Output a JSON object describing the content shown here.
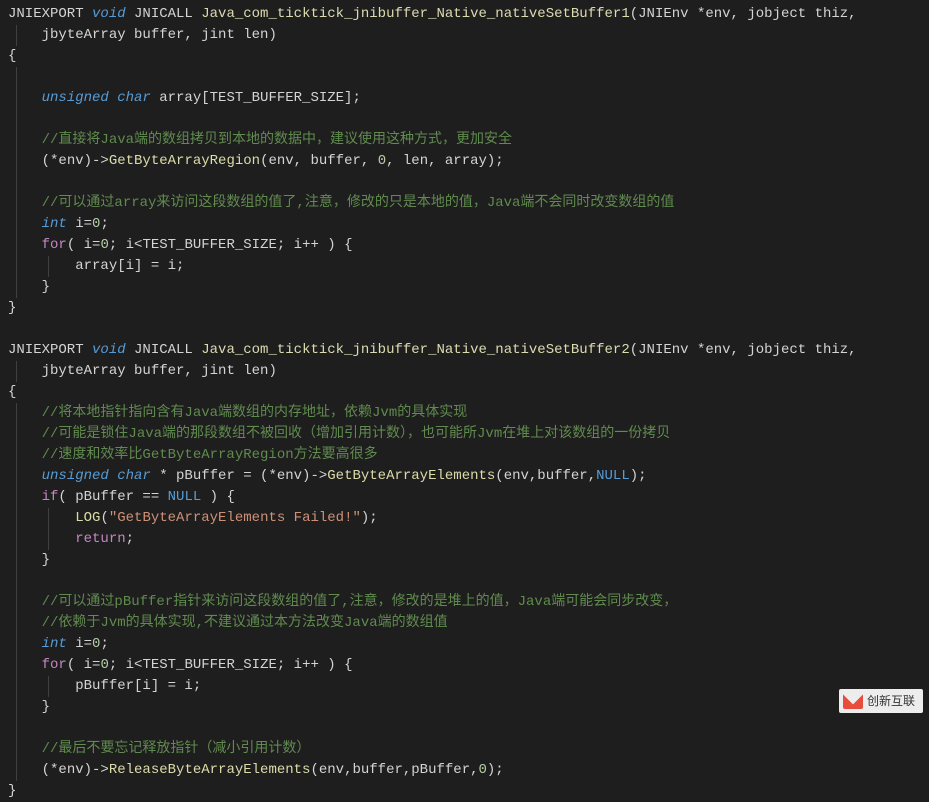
{
  "lines": [
    {
      "i": 0,
      "segs": [
        {
          "c": "macro",
          "t": "JNIEXPORT "
        },
        {
          "c": "kw-type",
          "t": "void"
        },
        {
          "c": "macro",
          "t": " JNICALL "
        },
        {
          "c": "fn-decl",
          "t": "Java_com_ticktick_jnibuffer_Native_nativeSetBuffer1"
        },
        {
          "c": "paren",
          "t": "(JNIEnv *env, jobject thiz, "
        }
      ]
    },
    {
      "i": 1,
      "segs": [
        {
          "c": "paren",
          "t": "jbyteArray buffer, jint len)"
        }
      ]
    },
    {
      "i": 0,
      "segs": [
        {
          "c": "paren",
          "t": "{"
        }
      ]
    },
    {
      "i": 1,
      "blank": true
    },
    {
      "i": 1,
      "segs": [
        {
          "c": "kw-type",
          "t": "unsigned char"
        },
        {
          "c": "op",
          "t": " array[TEST_BUFFER_SIZE];"
        }
      ]
    },
    {
      "i": 1,
      "blank": true
    },
    {
      "i": 1,
      "segs": [
        {
          "c": "comment2",
          "t": "//直接将Java端的数组拷贝到本地的数据中，建议使用这种方式，更加安全"
        }
      ]
    },
    {
      "i": 1,
      "segs": [
        {
          "c": "op",
          "t": "(*env)->"
        },
        {
          "c": "method",
          "t": "GetByteArrayRegion"
        },
        {
          "c": "op",
          "t": "(env, buffer, "
        },
        {
          "c": "num",
          "t": "0"
        },
        {
          "c": "op",
          "t": ", len, array);"
        }
      ]
    },
    {
      "i": 1,
      "blank": true
    },
    {
      "i": 1,
      "segs": [
        {
          "c": "comment2",
          "t": "//可以通过array来访问这段数组的值了,注意，修改的只是本地的值，Java端不会同时改变数组的值"
        }
      ]
    },
    {
      "i": 1,
      "segs": [
        {
          "c": "kw-type",
          "t": "int"
        },
        {
          "c": "op",
          "t": " i="
        },
        {
          "c": "num",
          "t": "0"
        },
        {
          "c": "op",
          "t": ";"
        }
      ]
    },
    {
      "i": 1,
      "segs": [
        {
          "c": "kw-ctrl",
          "t": "for"
        },
        {
          "c": "op",
          "t": "( i="
        },
        {
          "c": "num",
          "t": "0"
        },
        {
          "c": "op",
          "t": "; i<TEST_BUFFER_SIZE; i++ ) {"
        }
      ]
    },
    {
      "i": 2,
      "segs": [
        {
          "c": "op",
          "t": "array[i] = i;"
        }
      ]
    },
    {
      "i": 1,
      "segs": [
        {
          "c": "op",
          "t": "}"
        }
      ]
    },
    {
      "i": 0,
      "segs": [
        {
          "c": "op",
          "t": "}"
        }
      ]
    },
    {
      "i": 0,
      "blank": true
    },
    {
      "i": 0,
      "segs": [
        {
          "c": "macro",
          "t": "JNIEXPORT "
        },
        {
          "c": "kw-type",
          "t": "void"
        },
        {
          "c": "macro",
          "t": " JNICALL "
        },
        {
          "c": "fn-decl",
          "t": "Java_com_ticktick_jnibuffer_Native_nativeSetBuffer2"
        },
        {
          "c": "paren",
          "t": "(JNIEnv *env, jobject thiz, "
        }
      ]
    },
    {
      "i": 1,
      "segs": [
        {
          "c": "paren",
          "t": "jbyteArray buffer, jint len)"
        }
      ]
    },
    {
      "i": 0,
      "segs": [
        {
          "c": "paren",
          "t": "{"
        }
      ]
    },
    {
      "i": 1,
      "segs": [
        {
          "c": "comment2",
          "t": "//将本地指针指向含有Java端数组的内存地址，依赖Jvm的具体实现"
        }
      ]
    },
    {
      "i": 1,
      "segs": [
        {
          "c": "comment2",
          "t": "//可能是锁住Java端的那段数组不被回收（增加引用计数），也可能所Jvm在堆上对该数组的一份拷贝"
        }
      ]
    },
    {
      "i": 1,
      "segs": [
        {
          "c": "comment2",
          "t": "//速度和效率比GetByteArrayRegion方法要高很多"
        }
      ]
    },
    {
      "i": 1,
      "segs": [
        {
          "c": "kw-type",
          "t": "unsigned char"
        },
        {
          "c": "op",
          "t": " * pBuffer = (*env)->"
        },
        {
          "c": "method",
          "t": "GetByteArrayElements"
        },
        {
          "c": "op",
          "t": "(env,buffer,"
        },
        {
          "c": "null",
          "t": "NULL"
        },
        {
          "c": "op",
          "t": ");"
        }
      ]
    },
    {
      "i": 1,
      "segs": [
        {
          "c": "kw-ctrl",
          "t": "if"
        },
        {
          "c": "op",
          "t": "( pBuffer == "
        },
        {
          "c": "null",
          "t": "NULL"
        },
        {
          "c": "op",
          "t": " ) {"
        }
      ]
    },
    {
      "i": 2,
      "segs": [
        {
          "c": "method",
          "t": "LOG"
        },
        {
          "c": "op",
          "t": "("
        },
        {
          "c": "str",
          "t": "\"GetByteArrayElements Failed!\""
        },
        {
          "c": "op",
          "t": ");"
        }
      ]
    },
    {
      "i": 2,
      "segs": [
        {
          "c": "kw-ctrl",
          "t": "return"
        },
        {
          "c": "op",
          "t": ";"
        }
      ]
    },
    {
      "i": 1,
      "segs": [
        {
          "c": "op",
          "t": "}"
        }
      ]
    },
    {
      "i": 1,
      "blank": true
    },
    {
      "i": 1,
      "segs": [
        {
          "c": "comment2",
          "t": "//可以通过pBuffer指针来访问这段数组的值了,注意，修改的是堆上的值，Java端可能会同步改变，"
        }
      ]
    },
    {
      "i": 1,
      "segs": [
        {
          "c": "comment2",
          "t": "//依赖于Jvm的具体实现,不建议通过本方法改变Java端的数组值"
        }
      ]
    },
    {
      "i": 1,
      "segs": [
        {
          "c": "kw-type",
          "t": "int"
        },
        {
          "c": "op",
          "t": " i="
        },
        {
          "c": "num",
          "t": "0"
        },
        {
          "c": "op",
          "t": ";"
        }
      ]
    },
    {
      "i": 1,
      "segs": [
        {
          "c": "kw-ctrl",
          "t": "for"
        },
        {
          "c": "op",
          "t": "( i="
        },
        {
          "c": "num",
          "t": "0"
        },
        {
          "c": "op",
          "t": "; i<TEST_BUFFER_SIZE; i++ ) {"
        }
      ]
    },
    {
      "i": 2,
      "segs": [
        {
          "c": "op",
          "t": "pBuffer[i] = i;"
        }
      ]
    },
    {
      "i": 1,
      "segs": [
        {
          "c": "op",
          "t": "}"
        }
      ]
    },
    {
      "i": 1,
      "blank": true
    },
    {
      "i": 1,
      "segs": [
        {
          "c": "comment2",
          "t": "//最后不要忘记释放指针（减小引用计数）"
        }
      ]
    },
    {
      "i": 1,
      "segs": [
        {
          "c": "op",
          "t": "(*env)->"
        },
        {
          "c": "method",
          "t": "ReleaseByteArrayElements"
        },
        {
          "c": "op",
          "t": "(env,buffer,pBuffer,"
        },
        {
          "c": "num",
          "t": "0"
        },
        {
          "c": "op",
          "t": ");"
        }
      ]
    },
    {
      "i": 0,
      "segs": [
        {
          "c": "op",
          "t": "}"
        }
      ]
    }
  ],
  "watermark": "创新互联"
}
